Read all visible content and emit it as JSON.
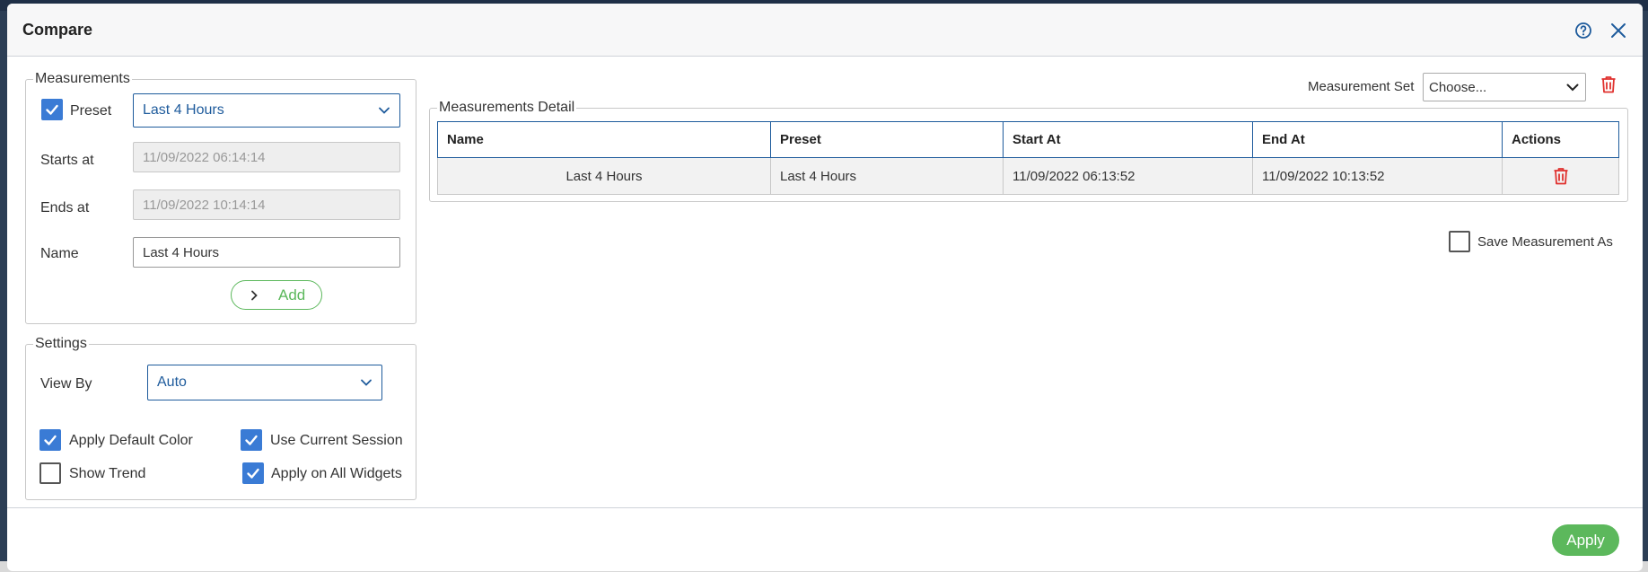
{
  "modal": {
    "title": "Compare"
  },
  "measurements": {
    "legend": "Measurements",
    "preset_label": "Preset",
    "preset_checked": true,
    "preset_value": "Last 4 Hours",
    "starts_label": "Starts at",
    "starts_value": "11/09/2022 06:14:14",
    "ends_label": "Ends at",
    "ends_value": "11/09/2022 10:14:14",
    "name_label": "Name",
    "name_value": "Last 4 Hours",
    "add_label": "Add"
  },
  "settings": {
    "legend": "Settings",
    "view_by_label": "View By",
    "view_by_value": "Auto",
    "apply_default_color": "Apply Default Color",
    "use_current_session": "Use Current Session",
    "show_trend": "Show Trend",
    "apply_all_widgets": "Apply on All Widgets"
  },
  "measurement_set": {
    "label": "Measurement Set",
    "value": "Choose..."
  },
  "detail": {
    "legend": "Measurements Detail",
    "columns": [
      "Name",
      "Preset",
      "Start At",
      "End At",
      "Actions"
    ],
    "rows": [
      {
        "name": "Last 4 Hours",
        "preset": "Last 4 Hours",
        "start": "11/09/2022 06:13:52",
        "end": "11/09/2022 10:13:52"
      }
    ]
  },
  "save_as_label": "Save Measurement As",
  "apply_label": "Apply",
  "colors": {
    "accent": "#3a7bd5",
    "select_text": "#1e5b9c",
    "success": "#5cb85c",
    "danger": "#e0312e"
  }
}
